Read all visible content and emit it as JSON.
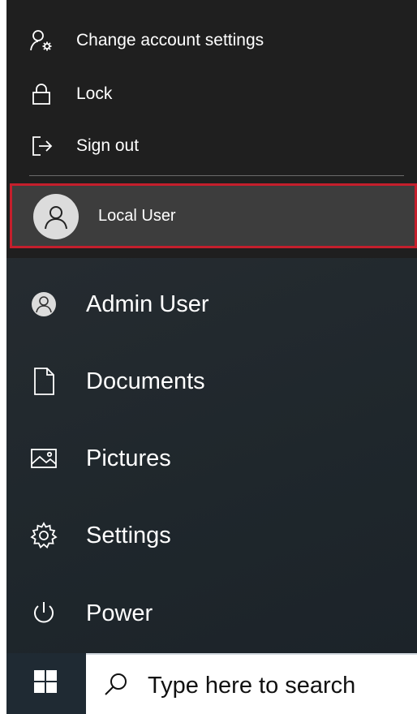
{
  "account_flyout": {
    "items": [
      {
        "label": "Change account settings",
        "icon": "person-gear-icon"
      },
      {
        "label": "Lock",
        "icon": "lock-icon"
      },
      {
        "label": "Sign out",
        "icon": "sign-out-icon"
      }
    ],
    "current_user": {
      "label": "Local User",
      "icon": "person-icon"
    }
  },
  "start_menu": {
    "items": [
      {
        "label": "Admin User",
        "icon": "avatar-icon"
      },
      {
        "label": "Documents",
        "icon": "document-icon"
      },
      {
        "label": "Pictures",
        "icon": "picture-icon"
      },
      {
        "label": "Settings",
        "icon": "gear-icon"
      },
      {
        "label": "Power",
        "icon": "power-icon"
      }
    ]
  },
  "taskbar": {
    "start_icon": "windows-logo-icon",
    "search_placeholder": "Type here to search",
    "search_icon": "search-icon"
  },
  "colors": {
    "highlight_border": "#c41f2c",
    "flyout_bg": "#1f1f1f",
    "panel_bg": "#252b30"
  }
}
